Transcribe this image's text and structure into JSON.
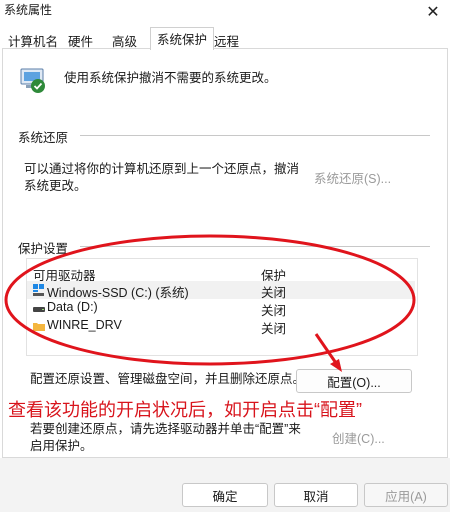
{
  "window": {
    "title": "系统属性",
    "close_label": "✕"
  },
  "tabs": [
    {
      "label": "计算机名",
      "active": false
    },
    {
      "label": "硬件",
      "active": false
    },
    {
      "label": "高级",
      "active": false
    },
    {
      "label": "系统保护",
      "active": true
    },
    {
      "label": "远程",
      "active": false
    }
  ],
  "intro": {
    "text": "使用系统保护撤消不需要的系统更改。",
    "icon": "system-protection-icon"
  },
  "restore_section": {
    "label": "系统还原",
    "text_line1": "可以通过将你的计算机还原到上一个还原点，撤消",
    "text_line2": "系统更改。",
    "button": "系统还原(S)..."
  },
  "protection_section": {
    "label": "保护设置",
    "columns": [
      "可用驱动器",
      "保护"
    ],
    "drives": [
      {
        "name": "Windows-SSD (C:) (系统)",
        "protection": "关闭",
        "icon": "windows-drive-icon",
        "selected": true
      },
      {
        "name": "Data (D:)",
        "protection": "关闭",
        "icon": "drive-icon",
        "selected": false
      },
      {
        "name": "WINRE_DRV",
        "protection": "关闭",
        "icon": "folder-icon",
        "selected": false
      }
    ],
    "configure_text": "配置还原设置、管理磁盘空间，并且删除还原点。",
    "configure_button": "配置(O)...",
    "create_text_line1": "若要创建还原点，请先选择驱动器并单击“配置”来",
    "create_text_line2": "启用保护。",
    "create_button": "创建(C)..."
  },
  "annotation": {
    "text": "查看该功能的开启状况后，如开启点击“配置”",
    "color": "#d8141c"
  },
  "footer": {
    "ok": "确定",
    "cancel": "取消",
    "apply": "应用(A)"
  }
}
